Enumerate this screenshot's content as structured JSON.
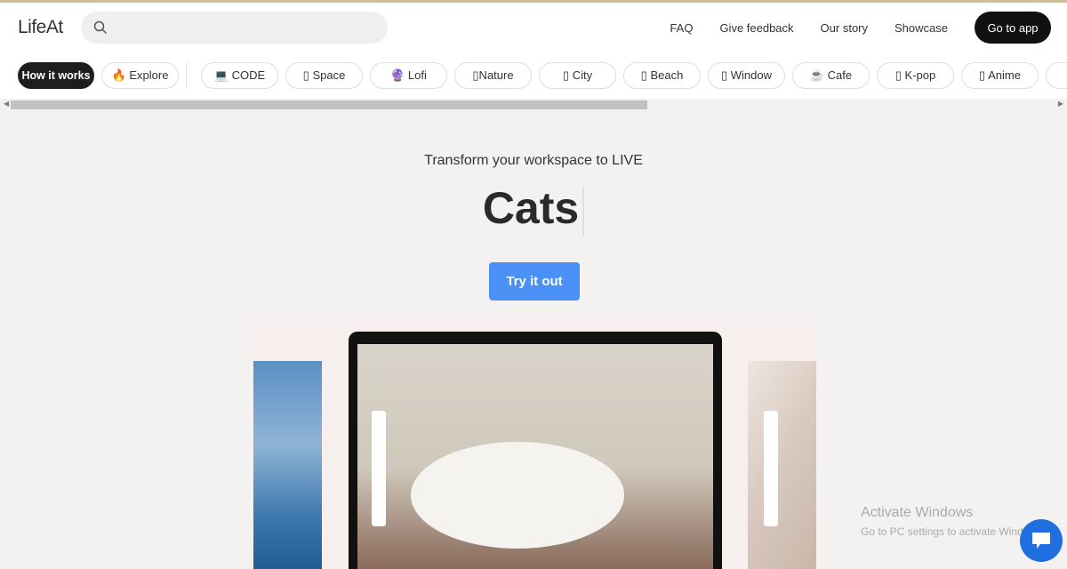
{
  "header": {
    "logo": "LifeAt",
    "search_placeholder": "",
    "nav": [
      "FAQ",
      "Give feedback",
      "Our story",
      "Showcase"
    ],
    "cta": "Go to app"
  },
  "categories": {
    "how": "How it works",
    "explore": "🔥 Explore",
    "items": [
      "💻 CODE",
      "▯ Space",
      "🔮 Lofi",
      "▯Nature",
      "▯ City",
      "▯ Beach",
      "▯ Window",
      "☕ Cafe",
      "▯ K-pop",
      "▯ Anime"
    ]
  },
  "hero": {
    "subtitle": "Transform your workspace to LIVE",
    "title": "Cats",
    "button": "Try it out"
  },
  "watermark": {
    "title": "Activate Windows",
    "subtitle": "Go to PC settings to activate Windows."
  },
  "colors": {
    "accent": "#4a90f5",
    "dark": "#1e1e1e",
    "chat": "#1f6fe0"
  }
}
